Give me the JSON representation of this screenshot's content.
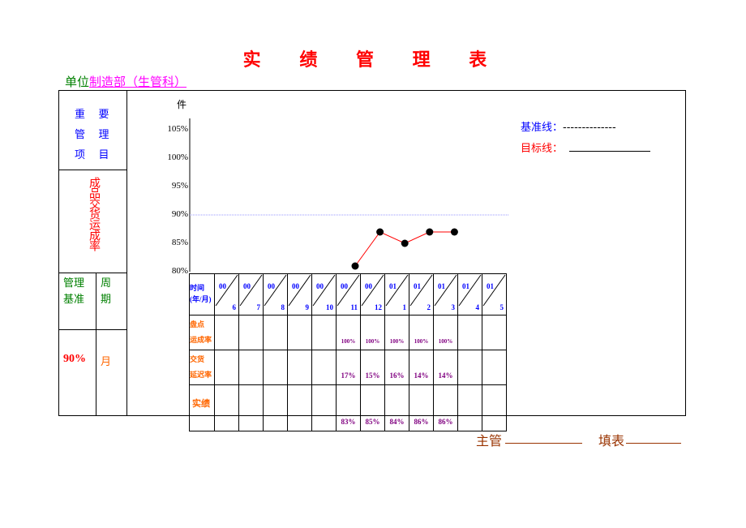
{
  "title": "实 绩 管 理 表",
  "unit": {
    "label": "单位",
    "value": "制造部（生管科）"
  },
  "left_panel": {
    "key_item_header": [
      "重",
      "要",
      "管",
      "理",
      "项",
      "目"
    ],
    "key_item": "成品交货运成率",
    "standard_header": "管理基准",
    "cycle_header": "周期",
    "standard_value": "90%",
    "cycle_value": "月"
  },
  "legend": {
    "baseline_label": "基准线：",
    "baseline_marker": "--------------",
    "target_label": "目标线："
  },
  "footer": {
    "supervisor_label": "主管",
    "filler_label": "填表"
  },
  "colors": {
    "title": "#ff0000",
    "accent_blue": "#0000ff",
    "line": "#ff0000",
    "target_line": "#9999ff"
  },
  "chart_data": {
    "type": "line",
    "ylabel": "件",
    "yticks": [
      "105%",
      "100%",
      "95%",
      "90%",
      "85%",
      "80%"
    ],
    "ylim": [
      80,
      105
    ],
    "target": 90,
    "categories": [
      {
        "yy": "00",
        "mm": "6"
      },
      {
        "yy": "00",
        "mm": "7"
      },
      {
        "yy": "00",
        "mm": "8"
      },
      {
        "yy": "00",
        "mm": "9"
      },
      {
        "yy": "00",
        "mm": "10"
      },
      {
        "yy": "00",
        "mm": "11"
      },
      {
        "yy": "00",
        "mm": "12"
      },
      {
        "yy": "01",
        "mm": "1"
      },
      {
        "yy": "01",
        "mm": "2"
      },
      {
        "yy": "01",
        "mm": "3"
      },
      {
        "yy": "01",
        "mm": "4"
      },
      {
        "yy": "01",
        "mm": "5"
      }
    ],
    "plotted_points": [
      {
        "index": 5,
        "value": 81
      },
      {
        "index": 6,
        "value": 87
      },
      {
        "index": 7,
        "value": 85
      },
      {
        "index": 8,
        "value": 87
      },
      {
        "index": 9,
        "value": 87
      }
    ],
    "table": {
      "time_label": [
        "时间",
        "(年/月)"
      ],
      "rows": [
        {
          "label": [
            "盘点",
            "运成率"
          ],
          "values": [
            "",
            "",
            "",
            "",
            "",
            "100%",
            "100%",
            "100%",
            "100%",
            "100%",
            "",
            ""
          ]
        },
        {
          "label": [
            "交货",
            "延迟率"
          ],
          "values": [
            "",
            "",
            "",
            "",
            "",
            "17%",
            "15%",
            "16%",
            "14%",
            "14%",
            "",
            ""
          ]
        },
        {
          "label": [
            "实绩"
          ],
          "values": [
            "",
            "",
            "",
            "",
            "",
            "83%",
            "85%",
            "84%",
            "86%",
            "86%",
            "",
            ""
          ]
        }
      ]
    }
  }
}
